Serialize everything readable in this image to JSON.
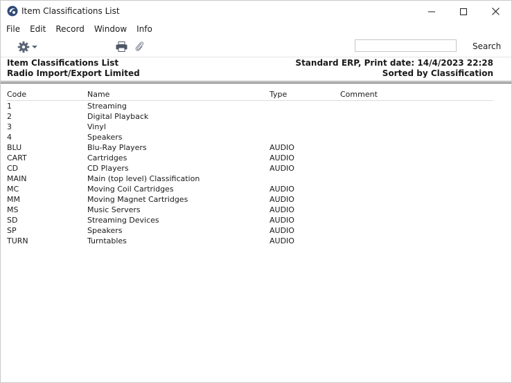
{
  "window": {
    "title": "Item Classifications List"
  },
  "menu": [
    "File",
    "Edit",
    "Record",
    "Window",
    "Info"
  ],
  "toolbar": {
    "search_value": "",
    "search_label": "Search"
  },
  "report": {
    "title": "Item Classifications List",
    "company": "Radio Import/Export Limited",
    "system_print": "Standard ERP, Print date: 14/4/2023 22:28",
    "sorted_by": "Sorted by Classification"
  },
  "columns": {
    "code": "Code",
    "name": "Name",
    "type": "Type",
    "comment": "Comment"
  },
  "rows": [
    {
      "code": "1",
      "name": "Streaming",
      "type": "",
      "comment": ""
    },
    {
      "code": "2",
      "name": "Digital Playback",
      "type": "",
      "comment": ""
    },
    {
      "code": "3",
      "name": "Vinyl",
      "type": "",
      "comment": ""
    },
    {
      "code": "4",
      "name": "Speakers",
      "type": "",
      "comment": ""
    },
    {
      "code": "BLU",
      "name": "Blu-Ray Players",
      "type": "AUDIO",
      "comment": ""
    },
    {
      "code": "CART",
      "name": "Cartridges",
      "type": "AUDIO",
      "comment": ""
    },
    {
      "code": "CD",
      "name": "CD Players",
      "type": "AUDIO",
      "comment": ""
    },
    {
      "code": "MAIN",
      "name": "Main (top level) Classification",
      "type": "",
      "comment": ""
    },
    {
      "code": "MC",
      "name": "Moving Coil Cartridges",
      "type": "AUDIO",
      "comment": ""
    },
    {
      "code": "MM",
      "name": "Moving Magnet Cartridges",
      "type": "AUDIO",
      "comment": ""
    },
    {
      "code": "MS",
      "name": "Music Servers",
      "type": "AUDIO",
      "comment": ""
    },
    {
      "code": "SD",
      "name": "Streaming Devices",
      "type": "AUDIO",
      "comment": ""
    },
    {
      "code": "SP",
      "name": "Speakers",
      "type": "AUDIO",
      "comment": ""
    },
    {
      "code": "TURN",
      "name": "Turntables",
      "type": "AUDIO",
      "comment": ""
    }
  ],
  "icons": [
    "app-icon",
    "minimize-icon",
    "maximize-icon",
    "close-icon",
    "gear-icon",
    "chevron-down-icon",
    "print-icon",
    "paperclip-icon"
  ]
}
